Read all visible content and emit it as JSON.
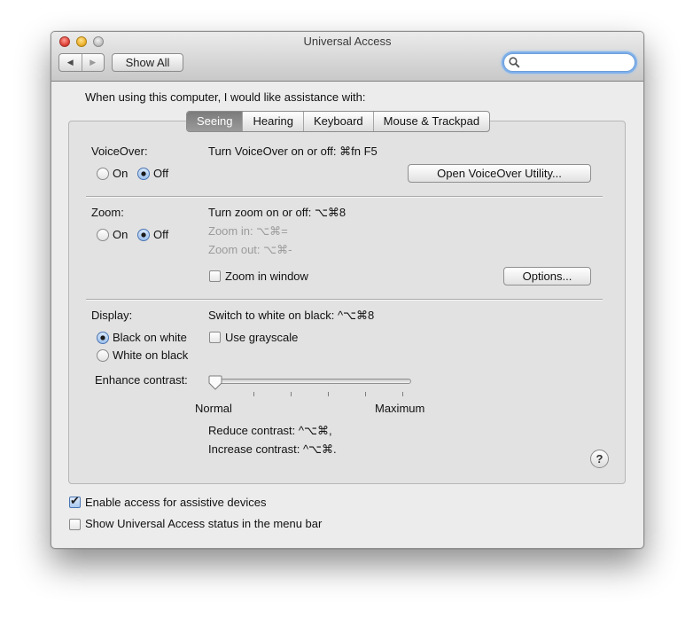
{
  "window": {
    "title": "Universal Access"
  },
  "toolbar": {
    "back_label": "◀",
    "forward_label": "▶",
    "show_all_label": "Show All",
    "search_placeholder": ""
  },
  "intro": "When using this computer, I would like assistance with:",
  "tabs": [
    "Seeing",
    "Hearing",
    "Keyboard",
    "Mouse & Trackpad"
  ],
  "active_tab": "Seeing",
  "voiceover": {
    "label": "VoiceOver:",
    "on_label": "On",
    "off_label": "Off",
    "selected": "Off",
    "shortcut": "Turn VoiceOver on or off: ⌘fn F5",
    "utility_button": "Open VoiceOver Utility..."
  },
  "zoom": {
    "label": "Zoom:",
    "on_label": "On",
    "off_label": "Off",
    "selected": "Off",
    "shortcut": "Turn zoom on or off: ⌥⌘8",
    "zoom_in": "Zoom in: ⌥⌘=",
    "zoom_out": "Zoom out: ⌥⌘-",
    "zoom_in_window_label": "Zoom in window",
    "zoom_in_window_checked": false,
    "options_button": "Options..."
  },
  "display": {
    "label": "Display:",
    "black_on_white": "Black on white",
    "white_on_black": "White on black",
    "selected": "Black on white",
    "switch_shortcut": "Switch to white on black: ^⌥⌘8",
    "grayscale_label": "Use grayscale",
    "grayscale_checked": false,
    "contrast_label": "Enhance contrast:",
    "contrast_min": "Normal",
    "contrast_max": "Maximum",
    "contrast_value": 0,
    "reduce_contrast": "Reduce contrast: ^⌥⌘,",
    "increase_contrast": "Increase contrast: ^⌥⌘."
  },
  "help_label": "?",
  "footer": {
    "assistive_label": "Enable access for assistive devices",
    "assistive_checked": true,
    "status_label": "Show Universal Access status in the menu bar",
    "status_checked": false
  }
}
